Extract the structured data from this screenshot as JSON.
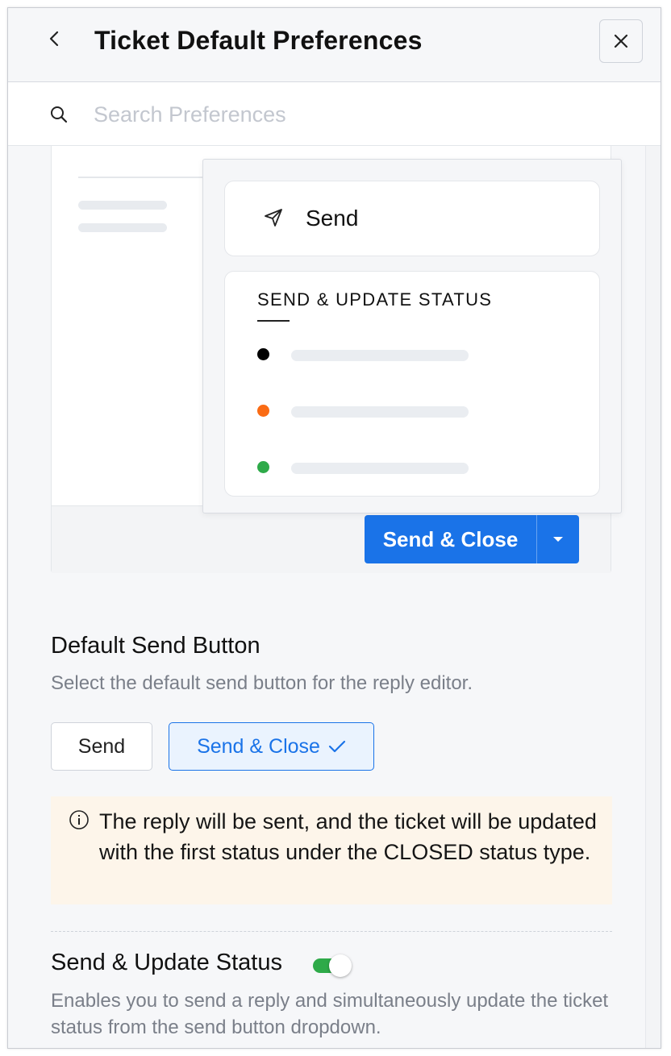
{
  "header": {
    "title": "Ticket Default Preferences"
  },
  "search": {
    "placeholder": "Search Preferences"
  },
  "preview": {
    "dropdown_send_label": "Send",
    "dropdown_status_heading": "SEND & UPDATE STATUS",
    "status_dot_colors": [
      "#000000",
      "#fa6b14",
      "#2eaa49"
    ],
    "split_button_label": "Send & Close"
  },
  "default_send_button": {
    "title": "Default Send Button",
    "description": "Select the default send button for the reply editor.",
    "options": [
      "Send",
      "Send & Close"
    ],
    "selected": "Send & Close",
    "info": "The reply will be sent, and the ticket will be updated with the first status under the CLOSED status type."
  },
  "send_update_status": {
    "title": "Send & Update Status",
    "enabled": true,
    "description": "Enables you to send a reply and simultaneously update the ticket status from the send button dropdown."
  },
  "colors": {
    "accent": "#1a73e8",
    "toggle_on": "#2eaa49",
    "info_bg": "#fdf5ea"
  }
}
